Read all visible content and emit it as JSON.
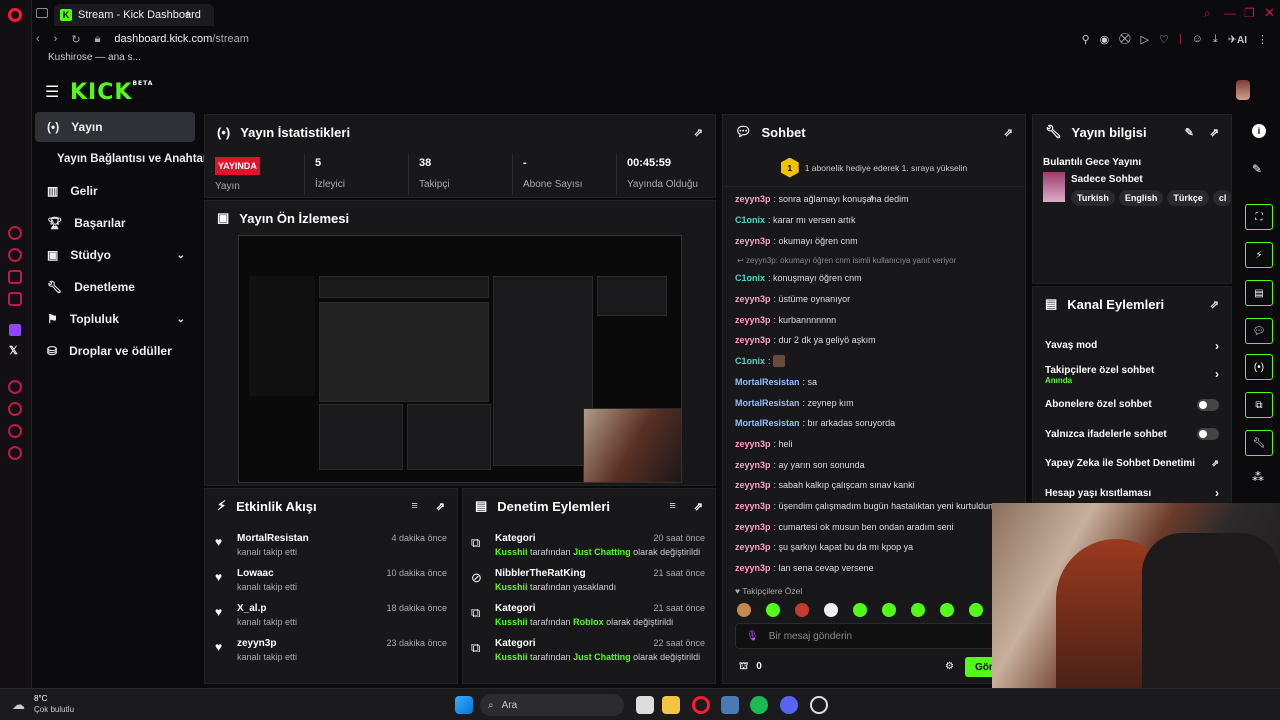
{
  "browser": {
    "tab_title": "Stream - Kick Dashboard",
    "url_host": "dashboard.kick.com",
    "url_path": "/stream",
    "bookmark": "Kushirose — ana s...",
    "ai_label": "AI"
  },
  "brand": {
    "logo": "KICK",
    "beta": "BETA",
    "accent": "#53fc18"
  },
  "sidebar": {
    "items": [
      {
        "label": "Yayın"
      },
      {
        "label": "Yayın Bağlantısı ve Anahtarı"
      },
      {
        "label": "Gelir"
      },
      {
        "label": "Başarılar"
      },
      {
        "label": "Stüdyo"
      },
      {
        "label": "Denetleme"
      },
      {
        "label": "Topluluk"
      },
      {
        "label": "Droplar ve ödüller"
      }
    ]
  },
  "stats": {
    "title": "Yayın İstatistikleri",
    "live_badge": "YAYINDA",
    "live_label": "Yayın",
    "viewers": "5",
    "viewers_label": "İzleyici",
    "followers": "38",
    "followers_label": "Takipçi",
    "subs": "-",
    "subs_label": "Abone Sayısı",
    "uptime": "00:45:59",
    "uptime_label": "Yayında Olduğu"
  },
  "preview": {
    "title": "Yayın Ön İzlemesi"
  },
  "activity": {
    "title": "Etkinlik Akışı",
    "items": [
      {
        "name": "MortalResistan",
        "sub": "kanalı takip etti",
        "time": "4 dakika önce"
      },
      {
        "name": "Lowaac",
        "sub": "kanalı takip etti",
        "time": "10 dakika önce"
      },
      {
        "name": "X_al.p",
        "sub": "kanalı takip etti",
        "time": "18 dakika önce"
      },
      {
        "name": "zeyyn3p",
        "sub": "kanalı takip etti",
        "time": "23 dakika önce"
      }
    ]
  },
  "moderation": {
    "title": "Denetim Eylemleri",
    "items": [
      {
        "title": "Kategori",
        "actor": "Kusshii",
        "pre": "tarafından",
        "target": "Just Chatting",
        "post": "olarak değiştirildi",
        "time": "20 saat önce"
      },
      {
        "title": "NibblerTheRatKing",
        "actor": "Kusshii",
        "pre": "tarafından yasaklandı",
        "target": "",
        "post": "",
        "time": "21 saat önce"
      },
      {
        "title": "Kategori",
        "actor": "Kusshii",
        "pre": "tarafından",
        "target": "Roblox",
        "post": "olarak değiştirildi",
        "time": "21 saat önce"
      },
      {
        "title": "Kategori",
        "actor": "Kusshii",
        "pre": "tarafından",
        "target": "Just Chatting",
        "post": "olarak değiştirildi",
        "time": "22 saat önce"
      }
    ]
  },
  "chat": {
    "title": "Sohbet",
    "banner": "1 abonelik hediye ederek 1. sıraya yükselin",
    "banner_rank": "1",
    "messages": [
      {
        "user": "zeyyn3p",
        "text": "sonra ağlamayı konuşana dedim",
        "c": "z"
      },
      {
        "user": "C1onix",
        "text": "karar mı versen artık",
        "c": "c"
      },
      {
        "user": "zeyyn3p",
        "text": "okumayı öğren cnm",
        "c": "z"
      },
      {
        "reply": "zeyyn3p: okumayı öğren cnm isimli kullanıcıya yanıt veriyor"
      },
      {
        "user": "C1onix",
        "text": "konuşmayı öğren cnm",
        "c": "c"
      },
      {
        "user": "zeyyn3p",
        "text": "üstüme oynanıyor",
        "c": "z"
      },
      {
        "user": "zeyyn3p",
        "text": "kurbannnnnnn",
        "c": "z"
      },
      {
        "user": "zeyyn3p",
        "text": "dur 2 dk ya geliyö aşkım",
        "c": "z"
      },
      {
        "user": "C1onix",
        "text": "",
        "c": "c"
      },
      {
        "user": "MortalResistan",
        "text": "sa",
        "c": "m"
      },
      {
        "user": "MortalResistan",
        "text": "zeynep kım",
        "c": "m"
      },
      {
        "user": "MortalResistan",
        "text": "bır arkadas soruyorda",
        "c": "m"
      },
      {
        "user": "zeyyn3p",
        "text": "heli",
        "c": "z"
      },
      {
        "user": "zeyyn3p",
        "text": "ay yarın son sonunda",
        "c": "z"
      },
      {
        "user": "zeyyn3p",
        "text": "sabah kalkıp çalışcam sınav kanki",
        "c": "z"
      },
      {
        "user": "zeyyn3p",
        "text": "üşendim çalışmadım bugün hastalıktan yeni kurtuldum",
        "c": "z"
      },
      {
        "user": "zeyyn3p",
        "text": "cumartesi ok musun ben ondan aradım seni",
        "c": "z"
      },
      {
        "user": "zeyyn3p",
        "text": "şu şarkıyı kapat bu da mı kpop ya",
        "c": "z"
      },
      {
        "user": "zeyyn3p",
        "text": "lan sena cevap versene",
        "c": "z"
      }
    ],
    "followers_only": "Takipçilere Özel",
    "input_placeholder": "Bir mesaj gönderin",
    "points": "0",
    "send_label": "Gön"
  },
  "stream_info": {
    "title": "Yayın bilgisi",
    "stream_title": "Bulantılı Gece Yayını",
    "category": "Sadece Sohbet",
    "tags": [
      "Turkish",
      "English",
      "Türkçe",
      "cl"
    ]
  },
  "channel_actions": {
    "title": "Kanal Eylemleri",
    "items": [
      {
        "label": "Yavaş mod",
        "kind": "arrow",
        "sub": ""
      },
      {
        "label": "Takipçilere özel sohbet",
        "kind": "arrow",
        "sub": "Anında"
      },
      {
        "label": "Abonelere özel sohbet",
        "kind": "toggle",
        "sub": ""
      },
      {
        "label": "Yalnızca ifadelerle sohbet",
        "kind": "toggle",
        "sub": ""
      },
      {
        "label": "Yapay Zeka ile Sohbet Denetimi",
        "kind": "external",
        "sub": ""
      },
      {
        "label": "Hesap yaşı kısıtlaması",
        "kind": "arrow",
        "sub": ""
      }
    ]
  },
  "taskbar": {
    "temp": "8°C",
    "weather": "Çok bulutlu",
    "search": "Ara"
  }
}
